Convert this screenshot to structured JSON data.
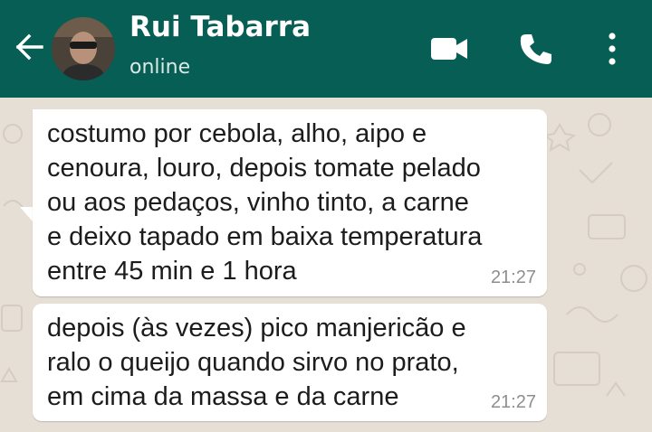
{
  "header": {
    "contact_name": "Rui Tabarra",
    "status": "online",
    "color": "#075e54",
    "icons": [
      "back-arrow-icon",
      "video-call-icon",
      "phone-call-icon",
      "more-options-icon"
    ]
  },
  "messages": [
    {
      "text": "costumo por cebola, alho, aipo e\ncenoura, louro, depois tomate pelado\nou aos pedaços, vinho tinto, a carne\ne deixo tapado em baixa temperatura\nentre 45 min e 1 hora",
      "time": "21:27"
    },
    {
      "text": "depois (às vezes) pico manjericão e\nralo o queijo quando sirvo no prato,\nem cima da massa e da carne",
      "time": "21:27"
    }
  ],
  "colors": {
    "chat_background": "#e6dfd6",
    "bubble": "#ffffff",
    "timestamp": "#8e8e8e"
  }
}
